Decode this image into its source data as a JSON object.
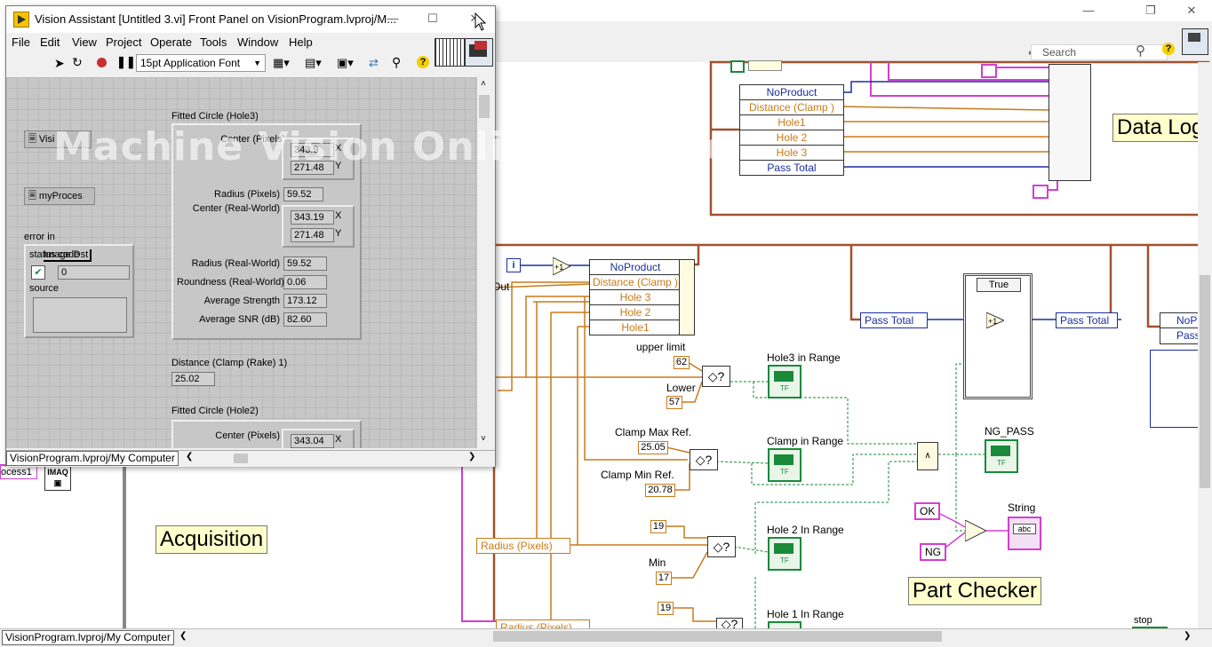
{
  "front_panel": {
    "title": "Vision Assistant [Untitled 3.vi] Front Panel on VisionProgram.lvproj/M...",
    "menu": [
      "File",
      "Edit",
      "View",
      "Project",
      "Operate",
      "Tools",
      "Window",
      "Help"
    ],
    "font_select": "15pt Application Font",
    "status_path": "VisionProgram.lvproj/My Computer",
    "controls": {
      "vision": "Visi",
      "myprocess": "myProces",
      "error_in": "error in",
      "status_code": "status code",
      "image_dst": "Image Dst",
      "code_value": "0",
      "source": "source"
    },
    "hole3": {
      "title": "Fitted Circle (Hole3)",
      "center_pixels_label": "Center (Pixels)",
      "center_x": "343.9",
      "center_y": "271.48",
      "radius_pixels_label": "Radius (Pixels)",
      "radius_pixels": "59.52",
      "center_rw_label": "Center (Real-World)",
      "center_rw_x": "343.19",
      "center_rw_y": "271.48",
      "radius_rw_label": "Radius (Real-World)",
      "radius_rw": "59.52",
      "roundness_label": "Roundness (Real-World)",
      "roundness": "0.06",
      "avg_strength_label": "Average Strength",
      "avg_strength": "173.12",
      "avg_snr_label": "Average SNR (dB)",
      "avg_snr": "82.60",
      "x_label": "X",
      "y_label": "Y"
    },
    "distance": {
      "title": "Distance (Clamp (Rake) 1)",
      "value": "25.02"
    },
    "hole2": {
      "title": "Fitted Circle (Hole2)",
      "center_pixels_label": "Center (Pixels)",
      "center_x": "343.04",
      "x_label": "X"
    }
  },
  "watermark": "Machine Vision Online Course",
  "block_diagram": {
    "search_placeholder": "Search",
    "status_path": "VisionProgram.lvproj/My Computer",
    "labels": {
      "data_log": "Data Log",
      "acquisition": "Acquisition",
      "part_checker": "Part Checker",
      "out": "Out",
      "process1": "ocess1",
      "imaq": "IMAQ",
      "stop": "stop"
    },
    "cluster_top": [
      "NoProduct",
      "Distance (Clamp )",
      "Hole1",
      "Hole 2",
      "Hole 3",
      "Pass Total"
    ],
    "cluster_mid": [
      "NoProduct",
      "Distance (Clamp )",
      "Hole 3",
      "Hole 2",
      "Hole1"
    ],
    "cluster_right": [
      "NoP",
      "Pass"
    ],
    "constants": {
      "upper_limit_label": "upper limit",
      "upper_limit": "62",
      "lower_label": "Lower",
      "lower": "57",
      "clamp_max_label": "Clamp  Max Ref.",
      "clamp_max": "25.05",
      "clamp_min_label": "Clamp Min Ref.",
      "clamp_min": "20.78",
      "hole2_max": "19",
      "min_label": "Min",
      "min": "17",
      "hole1_max": "19"
    },
    "indicators": {
      "hole3": "Hole3 in Range",
      "clamp": "Clamp in Range",
      "hole2": "Hole 2  In Range",
      "hole1": "Hole 1 In Range",
      "ng_pass": "NG_PASS",
      "string": "String"
    },
    "string_constants": {
      "ok": "OK",
      "ng": "NG"
    },
    "unbundles": {
      "pass_total_in": "Pass Total",
      "pass_total_out": "Pass Total",
      "radius_1": "Radius (Pixels)",
      "radius_2": "Radius (Pixels)"
    },
    "case_selector": "True"
  }
}
